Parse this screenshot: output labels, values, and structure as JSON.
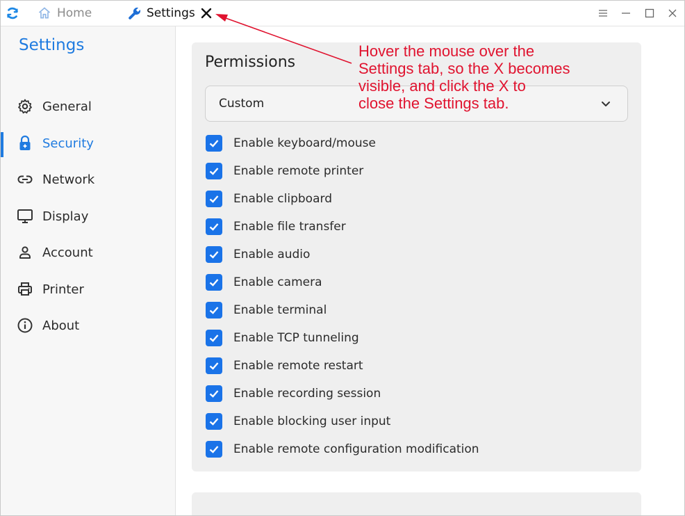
{
  "titlebar": {
    "tabs": [
      {
        "label": "Home",
        "icon": "home-icon"
      },
      {
        "label": "Settings",
        "icon": "wrench-icon"
      }
    ]
  },
  "sidebar": {
    "title": "Settings",
    "items": [
      {
        "label": "General",
        "icon": "gear-icon"
      },
      {
        "label": "Security",
        "icon": "lock-icon",
        "active": true
      },
      {
        "label": "Network",
        "icon": "link-icon"
      },
      {
        "label": "Display",
        "icon": "monitor-icon"
      },
      {
        "label": "Account",
        "icon": "user-icon"
      },
      {
        "label": "Printer",
        "icon": "printer-icon"
      },
      {
        "label": "About",
        "icon": "info-icon"
      }
    ]
  },
  "permissions": {
    "title": "Permissions",
    "mode": "Custom",
    "items": [
      {
        "label": "Enable keyboard/mouse",
        "checked": true
      },
      {
        "label": "Enable remote printer",
        "checked": true
      },
      {
        "label": "Enable clipboard",
        "checked": true
      },
      {
        "label": "Enable file transfer",
        "checked": true
      },
      {
        "label": "Enable audio",
        "checked": true
      },
      {
        "label": "Enable camera",
        "checked": true
      },
      {
        "label": "Enable terminal",
        "checked": true
      },
      {
        "label": "Enable TCP tunneling",
        "checked": true
      },
      {
        "label": "Enable remote restart",
        "checked": true
      },
      {
        "label": "Enable recording session",
        "checked": true
      },
      {
        "label": "Enable blocking user input",
        "checked": true
      },
      {
        "label": "Enable remote configuration modification",
        "checked": true
      }
    ]
  },
  "annotation": {
    "lines": [
      "Hover the mouse over the",
      "Settings tab, so the X becomes",
      "visible, and click the X to",
      "close the Settings tab."
    ]
  },
  "colors": {
    "accent": "#1f7be0",
    "checkbox": "#1a73e8",
    "annotation": "#e0132f"
  }
}
